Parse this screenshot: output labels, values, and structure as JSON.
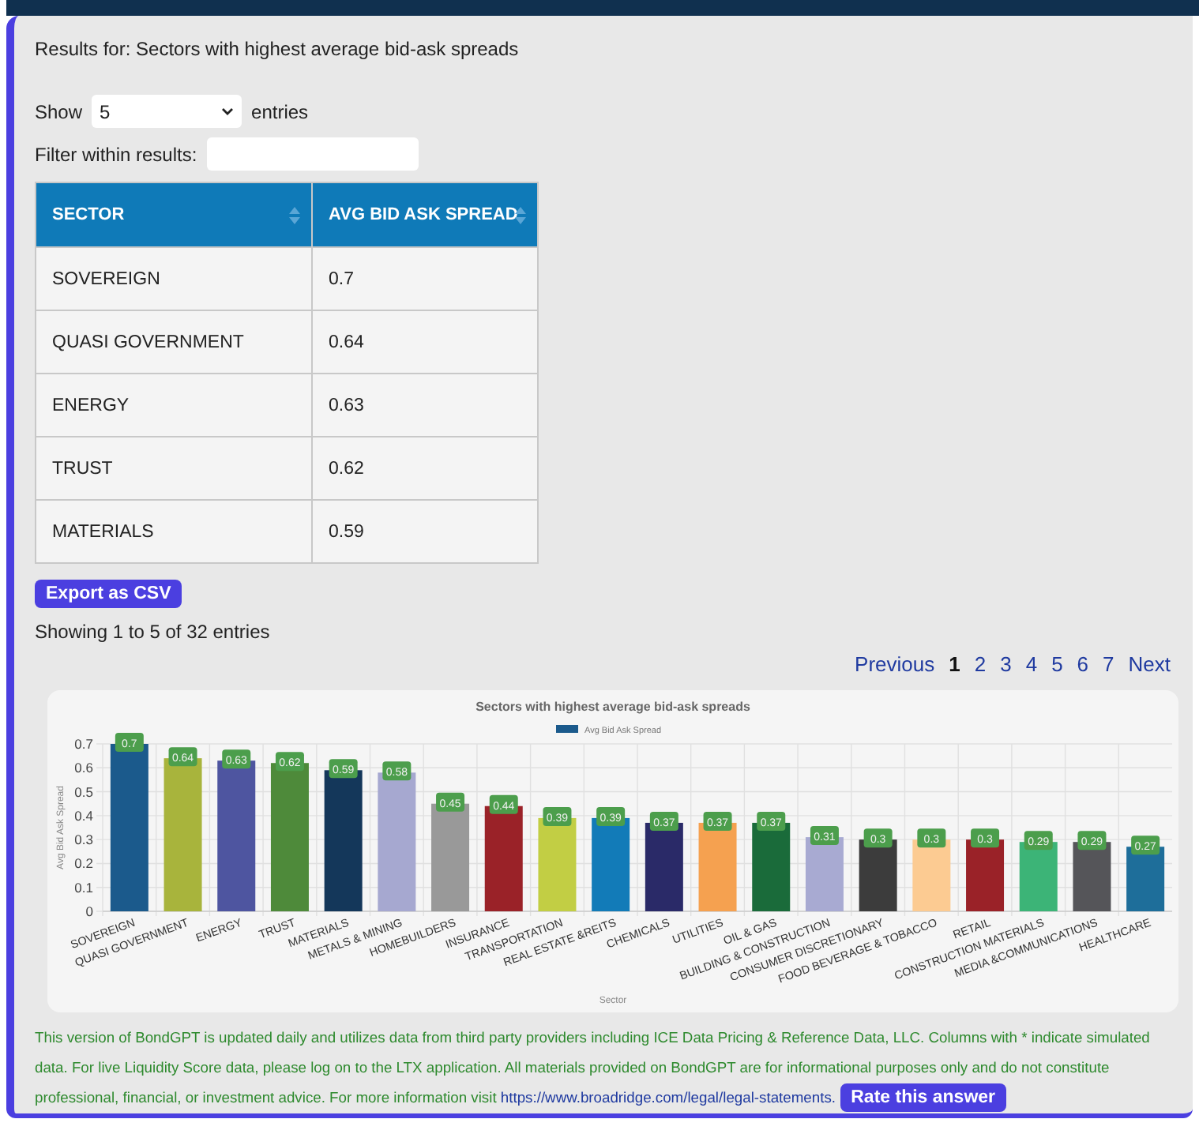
{
  "results_title": "Results for: Sectors with highest average bid-ask spreads",
  "length_control": {
    "label_before": "Show",
    "value": "5",
    "label_after": "entries"
  },
  "filter": {
    "label": "Filter within results:"
  },
  "table": {
    "columns": [
      "SECTOR",
      "AVG BID ASK SPREAD"
    ],
    "rows": [
      [
        "SOVEREIGN",
        "0.7"
      ],
      [
        "QUASI GOVERNMENT",
        "0.64"
      ],
      [
        "ENERGY",
        "0.63"
      ],
      [
        "TRUST",
        "0.62"
      ],
      [
        "MATERIALS",
        "0.59"
      ]
    ]
  },
  "export_button": "Export as CSV",
  "info": "Showing 1 to 5 of 32 entries",
  "pagination": {
    "previous": "Previous",
    "next": "Next",
    "pages": [
      {
        "label": "1",
        "selected": true
      },
      {
        "label": "2",
        "selected": false
      },
      {
        "label": "3",
        "selected": false
      },
      {
        "label": "4",
        "selected": false
      },
      {
        "label": "5",
        "selected": false
      },
      {
        "label": "6",
        "selected": false
      },
      {
        "label": "7",
        "selected": false
      }
    ]
  },
  "chart": {
    "chart_data": {
      "type": "bar",
      "title": "Sectors with highest average bid-ask spreads",
      "xlabel": "Sector",
      "ylabel": "Avg Bid Ask Spread",
      "ylim": [
        0,
        0.7
      ],
      "yticks": [
        0,
        0.1,
        0.2,
        0.3,
        0.4,
        0.5,
        0.6,
        0.7
      ],
      "data_labels": true,
      "grid": true,
      "categories": [
        "SOVEREIGN",
        "QUASI GOVERNMENT",
        "ENERGY",
        "TRUST",
        "MATERIALS",
        "METALS & MINING",
        "HOMEBUILDERS",
        "INSURANCE",
        "TRANSPORTATION",
        "REAL ESTATE &REITS",
        "CHEMICALS",
        "UTILITIES",
        "OIL & GAS",
        "BUILDING & CONSTRUCTION",
        "CONSUMER DISCRETIONARY",
        "FOOD BEVERAGE & TOBACCO",
        "RETAIL",
        "CONSTRUCTION MATERIALS",
        "MEDIA &COMMUNICATIONS",
        "HEALTHCARE"
      ],
      "series": [
        {
          "name": "Avg Bid Ask Spread",
          "color": "#1b5a8c",
          "values": [
            0.7,
            0.64,
            0.63,
            0.62,
            0.59,
            0.58,
            0.45,
            0.44,
            0.39,
            0.39,
            0.37,
            0.37,
            0.37,
            0.31,
            0.3,
            0.3,
            0.3,
            0.29,
            0.29,
            0.27
          ],
          "colors": [
            "#1b5a8c",
            "#a8b43c",
            "#4e55a0",
            "#4e8a3a",
            "#14375a",
            "#a6a8d0",
            "#999999",
            "#9a2228",
            "#c2ce44",
            "#127bb8",
            "#2a2a68",
            "#f5a150",
            "#1a6b3a",
            "#a8aad2",
            "#3c3c3c",
            "#fccb92",
            "#9a2228",
            "#3cb477",
            "#555559",
            "#1e6e9a"
          ]
        }
      ]
    }
  },
  "footer": {
    "text": "This version of BondGPT is updated daily and utilizes data from third party providers including ICE Data Pricing & Reference Data, LLC. Columns with * indicate simulated data. For live Liquidity Score data, please log on to the LTX application. All materials provided on BondGPT are for informational purposes only and do not constitute professional, financial, or investment advice. For more information visit ",
    "link": "https://www.broadridge.com/legal/legal-statements.",
    "rate_button": "Rate this answer"
  }
}
